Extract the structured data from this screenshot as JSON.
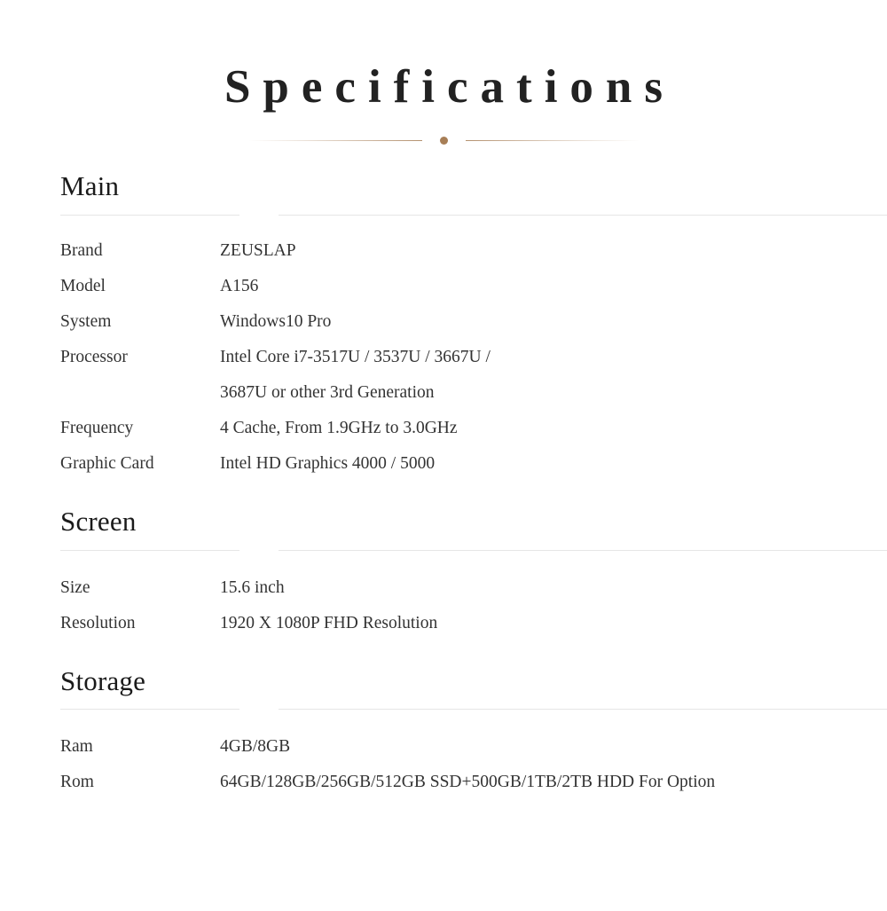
{
  "page": {
    "title": "Specifications",
    "ornament": {
      "dot_color": "#a77e56",
      "line_color": "#a77e56"
    },
    "rule_color": "#e6e6e6",
    "text_color": "#333333"
  },
  "sections": [
    {
      "heading": "Main",
      "rows": [
        {
          "label": "Brand",
          "value": "ZEUSLAP"
        },
        {
          "label": "Model",
          "value": "A156"
        },
        {
          "label": "System",
          "value": "Windows10 Pro"
        },
        {
          "label": "Processor",
          "value": "Intel Core i7-3517U / 3537U / 3667U /\n3687U or other 3rd Generation"
        },
        {
          "label": "Frequency",
          "value": "4 Cache, From 1.9GHz to 3.0GHz"
        },
        {
          "label": "Graphic Card",
          "value": "Intel HD Graphics 4000 / 5000"
        }
      ]
    },
    {
      "heading": "Screen",
      "rows": [
        {
          "label": "Size",
          "value": "15.6 inch"
        },
        {
          "label": "Resolution",
          "value": "1920 X 1080P FHD Resolution"
        }
      ]
    },
    {
      "heading": "Storage",
      "rows": [
        {
          "label": "Ram",
          "value": "4GB/8GB"
        },
        {
          "label": "Rom",
          "value": "64GB/128GB/256GB/512GB SSD+500GB/1TB/2TB HDD For Option"
        }
      ]
    }
  ]
}
